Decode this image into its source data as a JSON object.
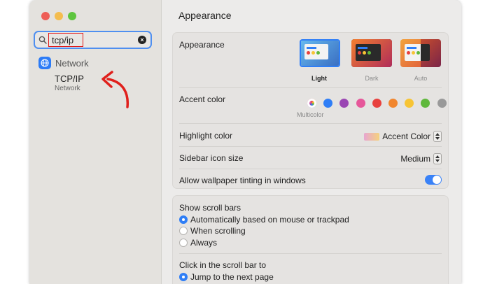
{
  "sidebar": {
    "search": {
      "value": "tcp/ip"
    },
    "section_label": "Network",
    "result": {
      "title": "TCP/IP",
      "subtitle": "Network"
    }
  },
  "main": {
    "title": "Appearance",
    "appearance": {
      "label": "Appearance",
      "options": [
        {
          "label": "Light",
          "selected": true
        },
        {
          "label": "Dark",
          "selected": false
        },
        {
          "label": "Auto",
          "selected": false
        }
      ]
    },
    "accent": {
      "label": "Accent color",
      "colors": [
        "#c975d6",
        "#2f7ef6",
        "#9a46b3",
        "#e6579a",
        "#e8413e",
        "#f1862e",
        "#f7c434",
        "#5fb83c",
        "#999999"
      ],
      "selected_label": "Multicolor"
    },
    "highlight": {
      "label": "Highlight color",
      "value": "Accent Color"
    },
    "sidebar_icon": {
      "label": "Sidebar icon size",
      "value": "Medium"
    },
    "wallpaper": {
      "label": "Allow wallpaper tinting in windows",
      "enabled": true
    },
    "scroll_bars": {
      "label": "Show scroll bars",
      "options": [
        {
          "label": "Automatically based on mouse or trackpad",
          "selected": true
        },
        {
          "label": "When scrolling",
          "selected": false
        },
        {
          "label": "Always",
          "selected": false
        }
      ]
    },
    "click_scroll": {
      "label": "Click in the scroll bar to",
      "options": [
        {
          "label": "Jump to the next page",
          "selected": true
        }
      ]
    }
  }
}
